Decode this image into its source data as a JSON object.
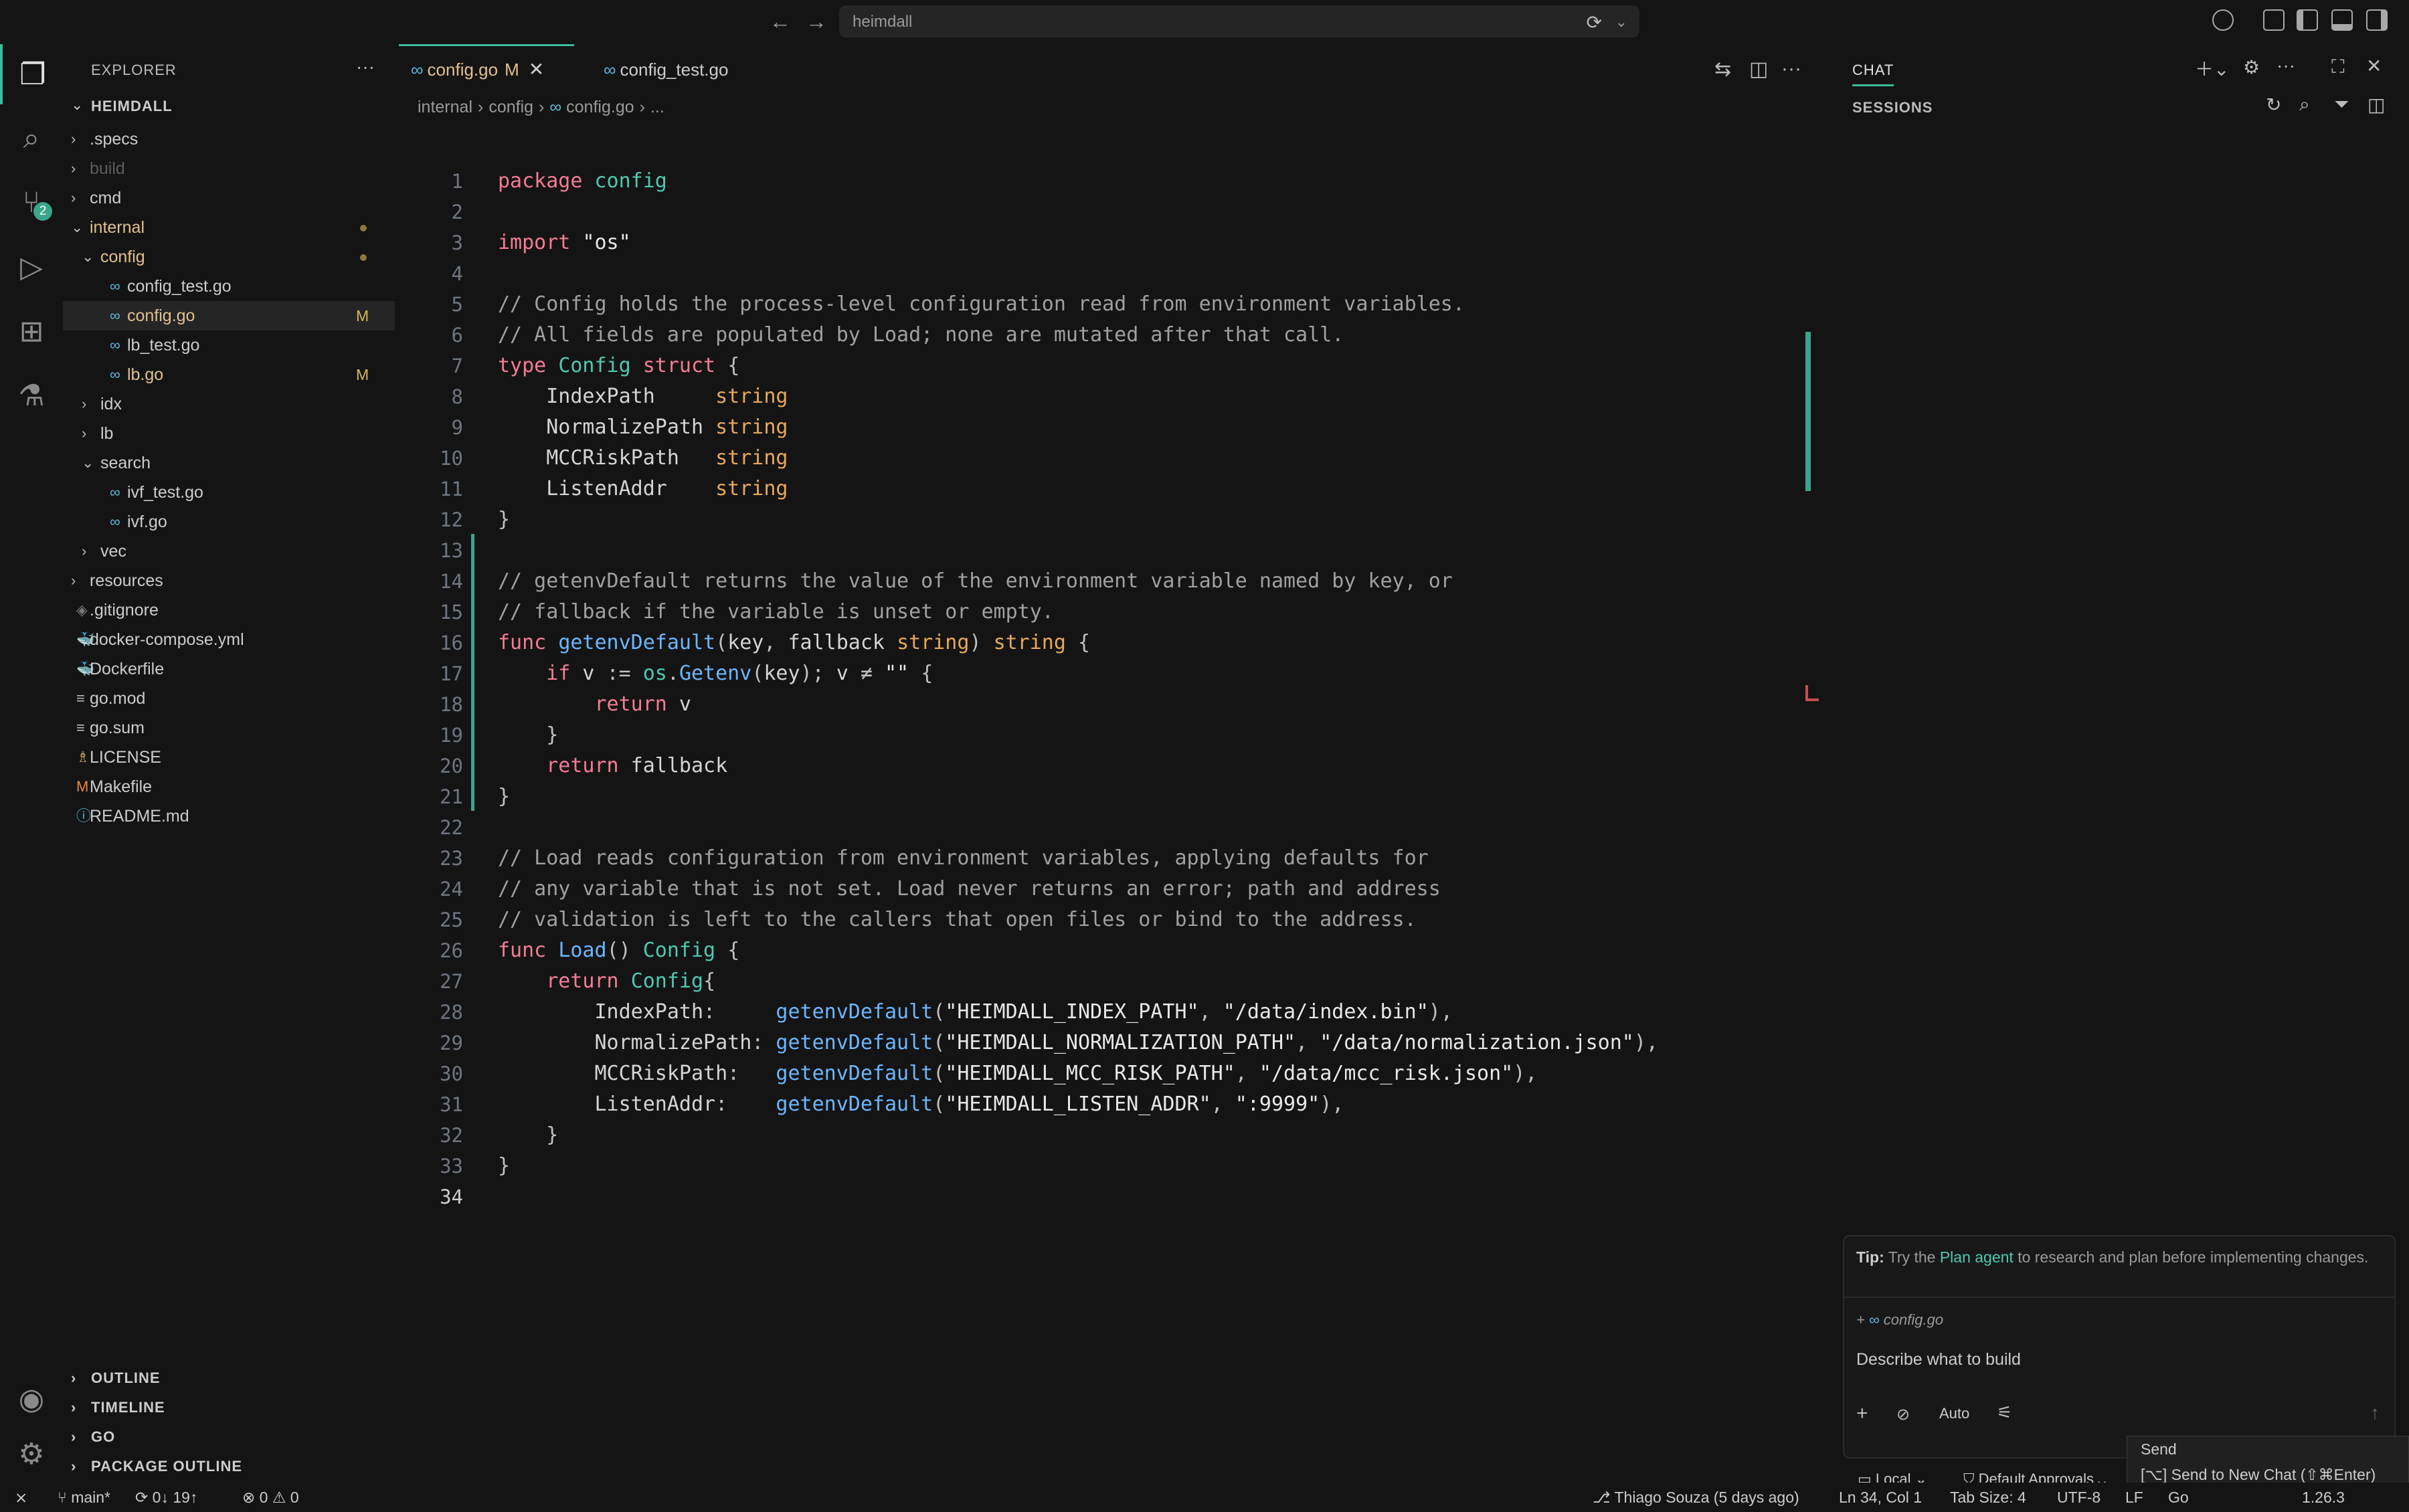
{
  "window": {
    "search_text": "heimdall"
  },
  "sidebar": {
    "title": "EXPLORER",
    "root": "HEIMDALL",
    "items": [
      {
        "label": ".specs",
        "kind": "folder",
        "depth": 1,
        "expanded": false
      },
      {
        "label": "build",
        "kind": "folder",
        "depth": 1,
        "expanded": false,
        "dim": true
      },
      {
        "label": "cmd",
        "kind": "folder",
        "depth": 1,
        "expanded": false
      },
      {
        "label": "internal",
        "kind": "folder",
        "depth": 1,
        "expanded": true,
        "modified": true
      },
      {
        "label": "config",
        "kind": "folder",
        "depth": 2,
        "expanded": true,
        "modified": true
      },
      {
        "label": "config_test.go",
        "kind": "go",
        "depth": 3
      },
      {
        "label": "config.go",
        "kind": "go",
        "depth": 3,
        "badge": "M",
        "selected": true
      },
      {
        "label": "lb_test.go",
        "kind": "go",
        "depth": 3
      },
      {
        "label": "lb.go",
        "kind": "go",
        "depth": 3,
        "badge": "M"
      },
      {
        "label": "idx",
        "kind": "folder",
        "depth": 2,
        "expanded": false
      },
      {
        "label": "lb",
        "kind": "folder",
        "depth": 2,
        "expanded": false
      },
      {
        "label": "search",
        "kind": "folder",
        "depth": 2,
        "expanded": true
      },
      {
        "label": "ivf_test.go",
        "kind": "go",
        "depth": 3
      },
      {
        "label": "ivf.go",
        "kind": "go",
        "depth": 3
      },
      {
        "label": "vec",
        "kind": "folder",
        "depth": 2,
        "expanded": false
      },
      {
        "label": "resources",
        "kind": "folder",
        "depth": 1,
        "expanded": false
      },
      {
        "label": ".gitignore",
        "kind": "git",
        "depth": 1
      },
      {
        "label": "docker-compose.yml",
        "kind": "docker",
        "depth": 1
      },
      {
        "label": "Dockerfile",
        "kind": "docker",
        "depth": 1
      },
      {
        "label": "go.mod",
        "kind": "text",
        "depth": 1
      },
      {
        "label": "go.sum",
        "kind": "text",
        "depth": 1
      },
      {
        "label": "LICENSE",
        "kind": "license",
        "depth": 1
      },
      {
        "label": "Makefile",
        "kind": "make",
        "depth": 1
      },
      {
        "label": "README.md",
        "kind": "info",
        "depth": 1
      }
    ],
    "sections": [
      "OUTLINE",
      "TIMELINE",
      "GO",
      "PACKAGE OUTLINE"
    ],
    "scm_badge": "2"
  },
  "editor": {
    "tabs": [
      {
        "label": "config.go",
        "modified": "M",
        "active": true
      },
      {
        "label": "config_test.go",
        "active": false
      }
    ],
    "breadcrumb": [
      "internal",
      "config",
      "config.go",
      "..."
    ],
    "lines": [
      "package config",
      "",
      "import \"os\"",
      "",
      "// Config holds the process-level configuration read from environment variables.",
      "// All fields are populated by Load; none are mutated after that call.",
      "type Config struct {",
      "    IndexPath     string",
      "    NormalizePath string",
      "    MCCRiskPath   string",
      "    ListenAddr    string",
      "}",
      "",
      "// getenvDefault returns the value of the environment variable named by key, or",
      "// fallback if the variable is unset or empty.",
      "func getenvDefault(key, fallback string) string {",
      "    if v := os.Getenv(key); v ≠ \"\" {",
      "        return v",
      "    }",
      "    return fallback",
      "}",
      "",
      "// Load reads configuration from environment variables, applying defaults for",
      "// any variable that is not set. Load never returns an error; path and address",
      "// validation is left to the callers that open files or bind to the address.",
      "func Load() Config {",
      "    return Config{",
      "        IndexPath:     getenvDefault(\"HEIMDALL_INDEX_PATH\", \"/data/index.bin\"),",
      "        NormalizePath: getenvDefault(\"HEIMDALL_NORMALIZATION_PATH\", \"/data/normalization.json\"),",
      "        MCCRiskPath:   getenvDefault(\"HEIMDALL_MCC_RISK_PATH\", \"/data/mcc_risk.json\"),",
      "        ListenAddr:    getenvDefault(\"HEIMDALL_LISTEN_ADDR\", \":9999\"),",
      "    }",
      "}",
      ""
    ],
    "current_line": 34
  },
  "chat": {
    "title": "CHAT",
    "sessions_title": "SESSIONS",
    "tip_prefix": "Tip:",
    "tip_before": " Try the ",
    "tip_link": "Plan agent",
    "tip_after": " to research and plan before implementing changes.",
    "context_file": "config.go",
    "placeholder": "Describe what to build",
    "mode": "Auto",
    "location": "Local",
    "approvals": "Default Approvals",
    "send_label": "Send",
    "send_new": "[⌥] Send to New Chat (⇧⌘Enter)"
  },
  "statusbar": {
    "branch": "main*",
    "sync": "0↓ 19↑",
    "errors": "0",
    "warnings": "0",
    "blame": "Thiago Souza (5 days ago)",
    "position": "Ln 34, Col 1",
    "tab_size": "Tab Size: 4",
    "encoding": "UTF-8",
    "eol": "LF",
    "language": "Go",
    "go_version": "1.26.3"
  }
}
